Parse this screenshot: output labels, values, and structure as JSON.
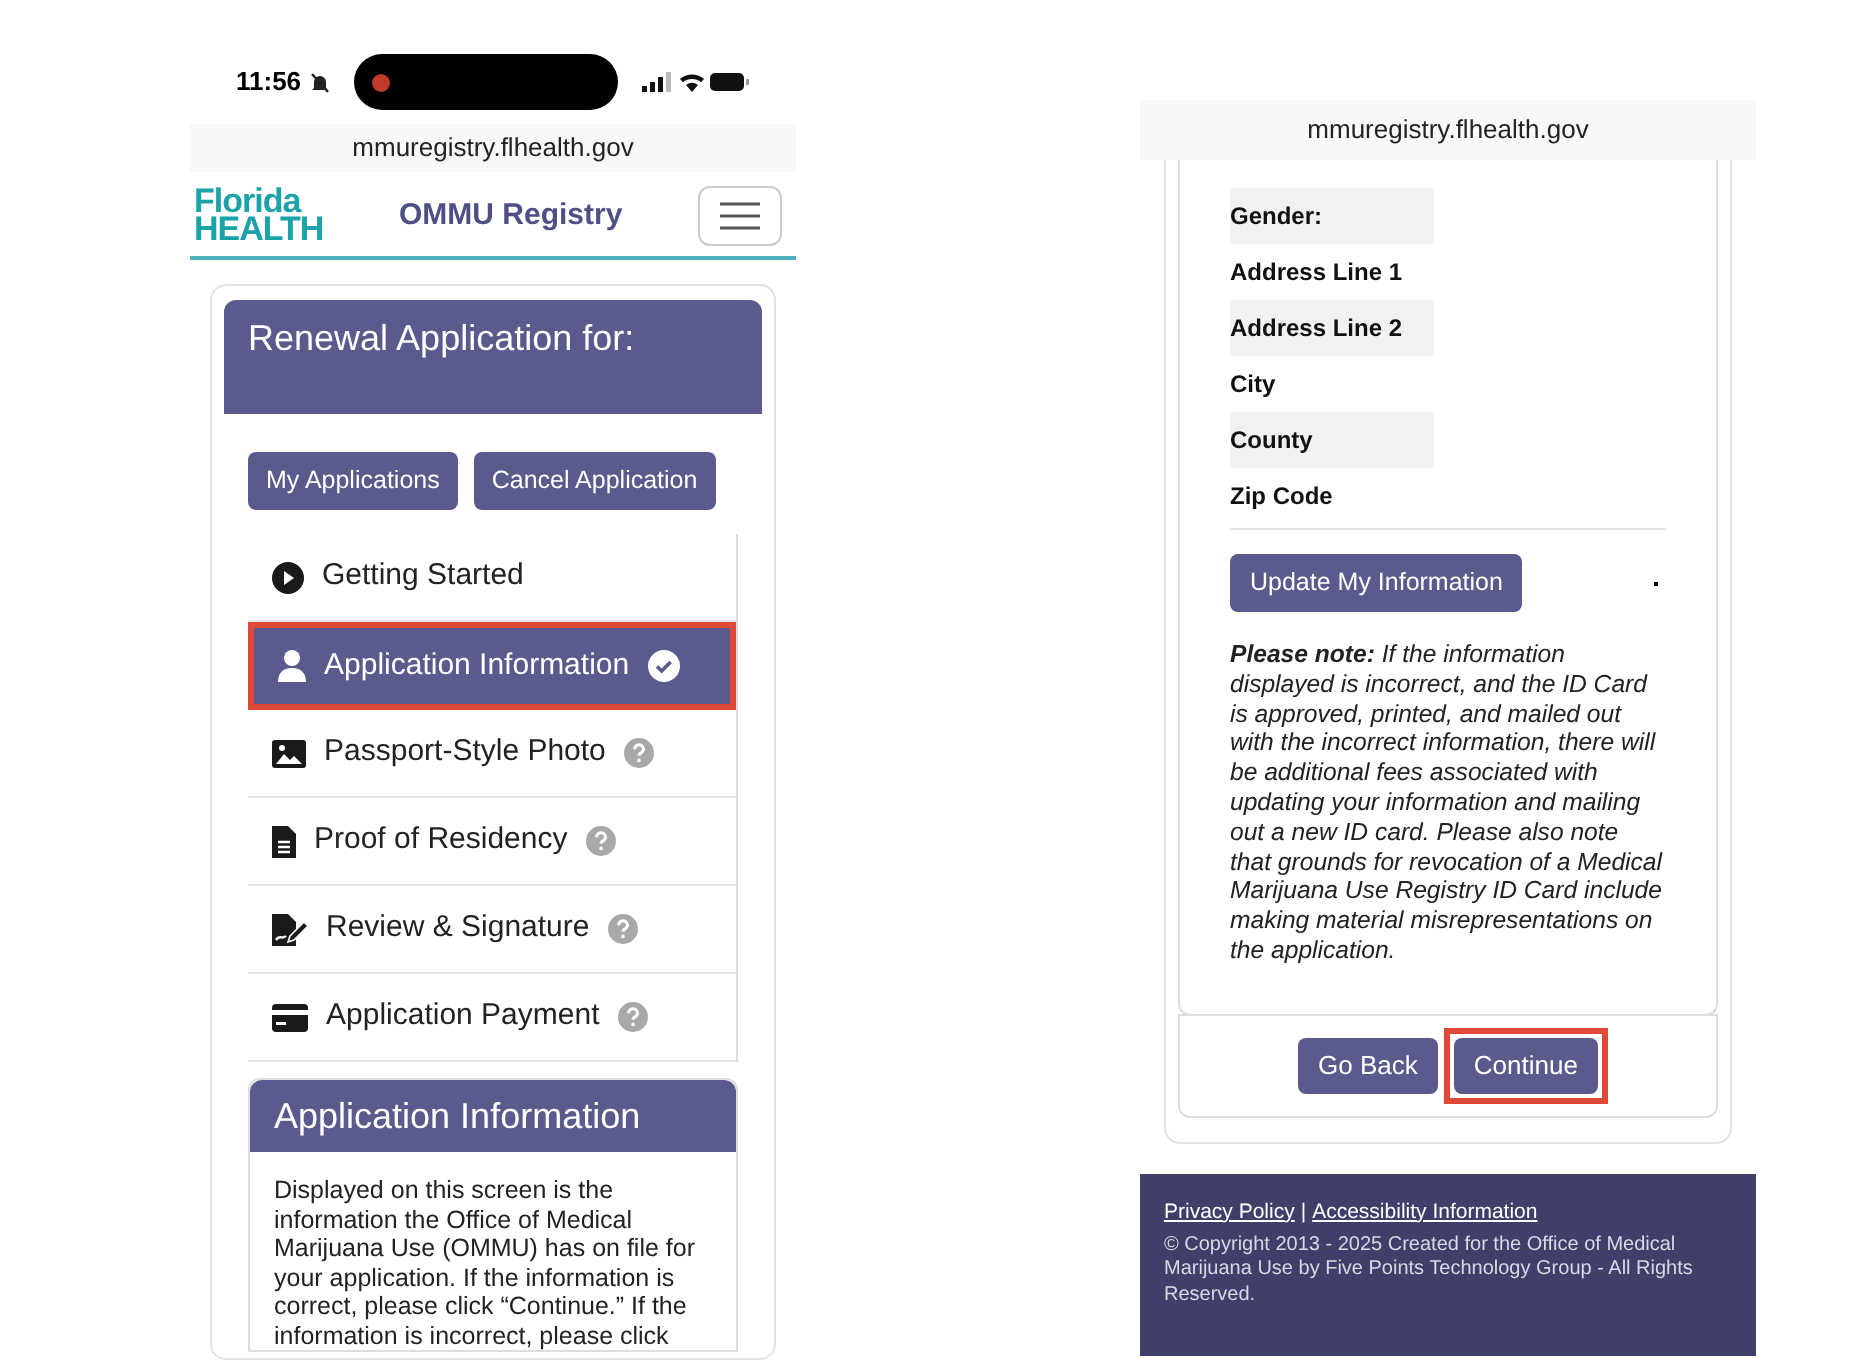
{
  "left_phone": {
    "status_bar": {
      "time": "11:56"
    },
    "url": "mmuregistry.flhealth.gov",
    "header": {
      "logo_top": "Florida",
      "logo_bottom": "HEALTH",
      "title": "OMMU Registry"
    },
    "card_title": "Renewal Application for:",
    "buttons": [
      "My Applications",
      "Cancel Application"
    ],
    "steps": [
      {
        "label": "Getting Started",
        "kind": "play",
        "completed": false,
        "help": false,
        "selected": false,
        "highlighted": false
      },
      {
        "label": "Application Information",
        "kind": "person",
        "completed": true,
        "help": false,
        "selected": true,
        "highlighted": true
      },
      {
        "label": "Passport-Style Photo",
        "kind": "image",
        "completed": false,
        "help": true,
        "selected": false,
        "highlighted": false
      },
      {
        "label": "Proof of Residency",
        "kind": "file",
        "completed": false,
        "help": true,
        "selected": false,
        "highlighted": false
      },
      {
        "label": "Review & Signature",
        "kind": "sign",
        "completed": false,
        "help": true,
        "selected": false,
        "highlighted": false
      },
      {
        "label": "Application Payment",
        "kind": "card",
        "completed": false,
        "help": true,
        "selected": false,
        "highlighted": false
      }
    ],
    "section_title": "Application Information",
    "section_lines": [
      "Displayed on this screen is the",
      "information the Office of Medical",
      "Marijuana Use (OMMU) has on file for",
      "your application. If the information is",
      "correct, please click “Continue.” If the",
      "information is incorrect, please click"
    ]
  },
  "right_phone": {
    "url": "mmuregistry.flhealth.gov",
    "fields": [
      {
        "label": "Gender:",
        "shaded": true
      },
      {
        "label": "Address Line 1",
        "shaded": false
      },
      {
        "label": "Address Line 2",
        "shaded": true
      },
      {
        "label": "City",
        "shaded": false
      },
      {
        "label": "County",
        "shaded": true
      },
      {
        "label": "Zip Code",
        "shaded": false
      }
    ],
    "update_button": "Update My Information",
    "note": "**Please note:** If the information displayed is incorrect, and the ID Card is approved, printed, and mailed out with the incorrect information, there will be additional fees associated with updating your information and mailing out a new ID card. Please also note that grounds for revocation of a Medical Marijuana Use Registry ID Card include making material misrepresentations on the application.",
    "actions": [
      {
        "label": "Go Back",
        "highlighted": false
      },
      {
        "label": "Continue",
        "highlighted": true
      }
    ],
    "footer": {
      "links": [
        "Privacy Policy",
        "Accessibility Information"
      ],
      "separator": "|",
      "copyright": "© Copyright 2013 - 2025 Created for the Office of Medical Marijuana Use by Five Points Technology Group - All Rights Reserved."
    }
  }
}
